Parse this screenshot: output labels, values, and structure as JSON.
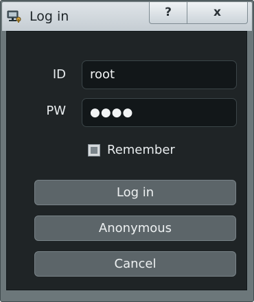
{
  "window": {
    "title": "Log in",
    "icon": "login-app-icon",
    "help_label": "?",
    "close_label": "x"
  },
  "form": {
    "id_label": "ID",
    "id_value": "root",
    "pw_label": "PW",
    "pw_value": "●●●●",
    "remember_label": "Remember",
    "remember_checked": "indeterminate"
  },
  "buttons": {
    "login_label": "Log in",
    "anonymous_label": "Anonymous",
    "cancel_label": "Cancel"
  },
  "colors": {
    "background": "#1f2426",
    "button": "#5c6569",
    "text": "#e8ecee"
  }
}
